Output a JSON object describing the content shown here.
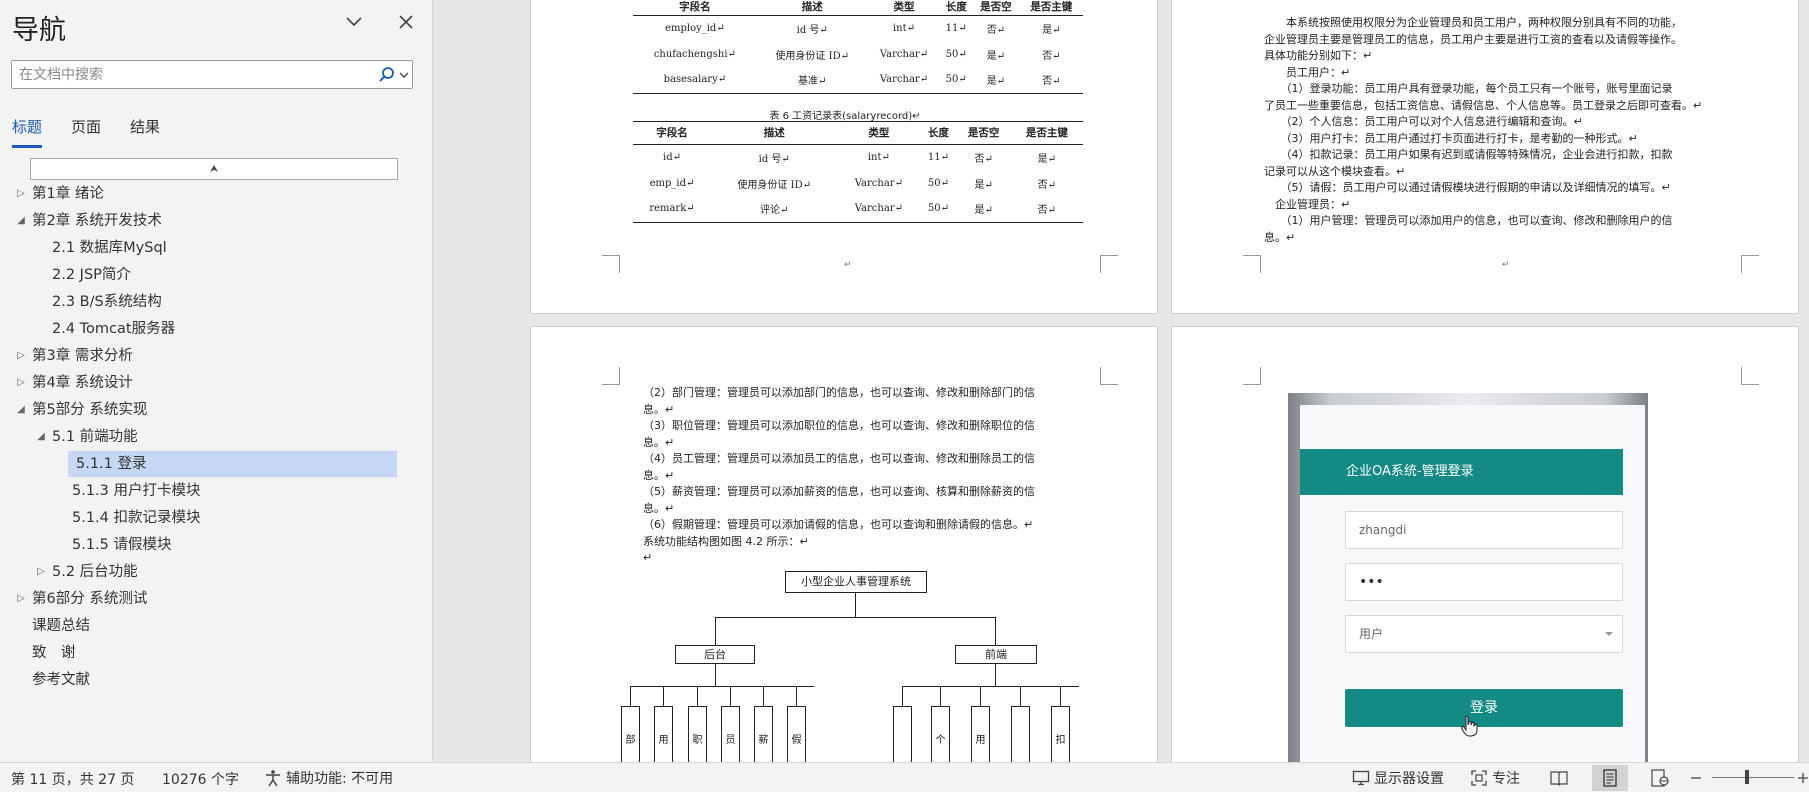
{
  "nav": {
    "title": "导航",
    "search_placeholder": "在文档中搜索",
    "tabs": [
      "标题",
      "页面",
      "结果"
    ],
    "collapse_glyph": "⮝",
    "tree": [
      {
        "label": "第1章 绪论",
        "level": 0,
        "state": "collapsed"
      },
      {
        "label": "第2章 系统开发技术",
        "level": 0,
        "state": "expanded"
      },
      {
        "label": "2.1 数据库MySql",
        "level": 1,
        "state": "leaf"
      },
      {
        "label": "2.2 JSP简介",
        "level": 1,
        "state": "leaf"
      },
      {
        "label": "2.3 B/S系统结构",
        "level": 1,
        "state": "leaf"
      },
      {
        "label": "2.4 Tomcat服务器",
        "level": 1,
        "state": "leaf"
      },
      {
        "label": "第3章 需求分析",
        "level": 0,
        "state": "collapsed"
      },
      {
        "label": "第4章 系统设计",
        "level": 0,
        "state": "collapsed"
      },
      {
        "label": "第5部分 系统实现",
        "level": 0,
        "state": "expanded"
      },
      {
        "label": "5.1 前端功能",
        "level": 1,
        "state": "expanded"
      },
      {
        "label": "5.1.1 登录",
        "level": 2,
        "state": "leaf",
        "selected": true
      },
      {
        "label": "5.1.3 用户打卡模块",
        "level": 2,
        "state": "leaf"
      },
      {
        "label": "5.1.4 扣款记录模块",
        "level": 2,
        "state": "leaf"
      },
      {
        "label": "5.1.5 请假模块",
        "level": 2,
        "state": "leaf"
      },
      {
        "label": "5.2 后台功能",
        "level": 1,
        "state": "collapsed"
      },
      {
        "label": "第6部分 系统测试",
        "level": 0,
        "state": "collapsed"
      },
      {
        "label": "课题总结",
        "level": 0,
        "state": "leaf"
      },
      {
        "label": "致　谢",
        "level": 0,
        "state": "leaf"
      },
      {
        "label": "参考文献",
        "level": 0,
        "state": "leaf"
      }
    ]
  },
  "pages": {
    "p1": {
      "table1": {
        "headers": [
          "字段名",
          "描述",
          "类型",
          "长度",
          "是否空",
          "是否主键"
        ],
        "rows": [
          [
            "employ_id↵",
            "id 号↵",
            "int↵",
            "11↵",
            "否↵",
            "是↵"
          ],
          [
            "chufachengshi↵",
            "使用身份证 ID↵",
            "Varchar↵",
            "50↵",
            "是↵",
            "否↵"
          ],
          [
            "basesalary↵",
            "基准↵",
            "Varchar↵",
            "50↵",
            "是↵",
            "否↵"
          ]
        ]
      },
      "caption2": "表 6 工资记录表(salaryrecord)↵",
      "table2": {
        "headers": [
          "字段名",
          "描述",
          "类型",
          "长度",
          "是否空",
          "是否主键"
        ],
        "rows": [
          [
            "id↵",
            "id 号↵",
            "int↵",
            "11↵",
            "否↵",
            "是↵"
          ],
          [
            "emp_id↵",
            "使用身份证 ID↵",
            "Varchar↵",
            "50↵",
            "是↵",
            "否↵"
          ],
          [
            "remark↵",
            "评论↵",
            "Varchar↵",
            "50↵",
            "是↵",
            "否↵"
          ]
        ]
      },
      "foot_mark": "↵"
    },
    "p2": {
      "lines": [
        "　　本系统按照使用权限分为企业管理员和员工用户，两种权限分别具有不同的功能，",
        "企业管理员主要是管理员工的信息，员工用户主要是进行工资的查看以及请假等操作。",
        "具体功能分别如下：↵",
        "　　员工用户：↵",
        "　　（1）登录功能：员工用户具有登录功能，每个员工只有一个账号，账号里面记录",
        "了员工一些重要信息，包括工资信息、请假信息、个人信息等。员工登录之后即可查看。↵",
        "　　（2）个人信息：员工用户可以对个人信息进行编辑和查询。↵",
        "　　（3）用户打卡：员工用户通过打卡页面进行打卡，是考勤的一种形式。↵",
        "　　（4）扣款记录：员工用户如果有迟到或请假等特殊情况，企业会进行扣款，扣款",
        "记录可以从这个模块查看。↵",
        "　　（5）请假：员工用户可以通过请假模块进行假期的申请以及详细情况的填写。↵",
        "　企业管理员：↵",
        "　　（1）用户管理：管理员可以添加用户的信息，也可以查询、修改和删除用户的信",
        "息。↵"
      ],
      "foot_mark": "↵"
    },
    "p3": {
      "lines": [
        "（2）部门管理：管理员可以添加部门的信息，也可以查询、修改和删除部门的信",
        "息。↵",
        "（3）职位管理：管理员可以添加职位的信息，也可以查询、修改和删除职位的信",
        "息。↵",
        "（4）员工管理：管理员可以添加员工的信息，也可以查询、修改和删除员工的信",
        "息。↵",
        "（5）薪资管理：管理员可以添加薪资的信息，也可以查询、核算和删除薪资的信",
        "息。↵",
        "（6）假期管理：管理员可以添加请假的信息，也可以查询和删除请假的信息。↵",
        "系统功能结构图如图 4.2 所示：↵",
        "↵"
      ],
      "org": {
        "root": "小型企业人事管理系统",
        "left": "后台",
        "right": "前端",
        "left_leaves": [
          "部",
          "用",
          "职",
          "员",
          "薪",
          "假"
        ],
        "right_leaves": [
          "",
          "个",
          "用",
          "",
          "扣"
        ]
      }
    },
    "p4": {
      "login": {
        "header": "企业OA系统-管理登录",
        "username": "zhangdi",
        "password": "•••",
        "role": "用户",
        "button": "登录"
      }
    }
  },
  "status": {
    "page": "第 11 页，共 27 页",
    "words": "10276 个字",
    "accessibility": "辅助功能: 不可用",
    "display": "显示器设置",
    "focus": "专注"
  }
}
